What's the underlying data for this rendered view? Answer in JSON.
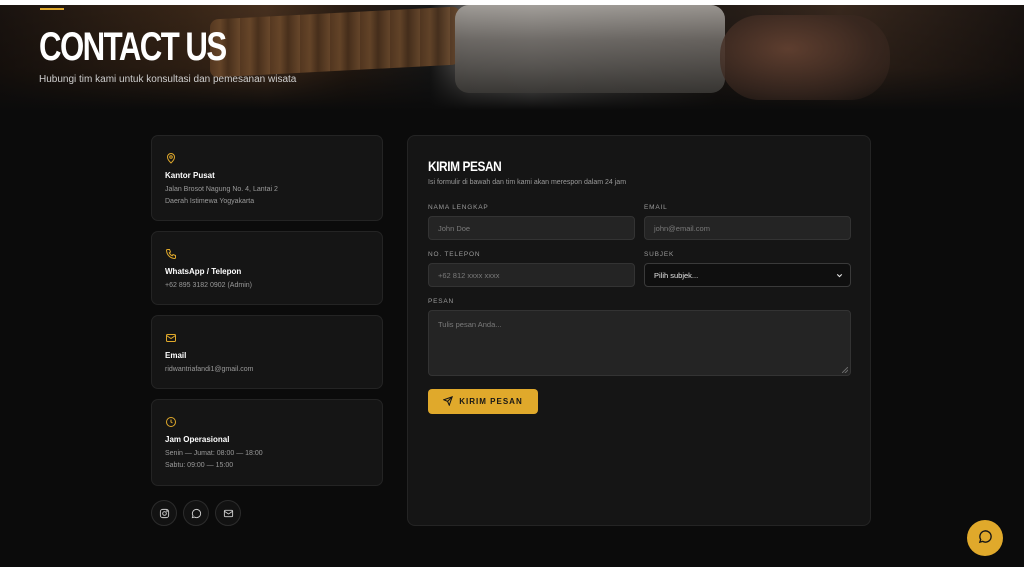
{
  "hero": {
    "title": "CONTACT US",
    "subtitle": "Hubungi tim kami untuk konsultasi dan pemesanan wisata"
  },
  "contact_cards": [
    {
      "icon": "map-pin-icon",
      "title": "Kantor Pusat",
      "lines": [
        "Jalan Brosot Nagung No. 4, Lantai 2",
        "Daerah Istimewa Yogyakarta"
      ]
    },
    {
      "icon": "phone-icon",
      "title": "WhatsApp / Telepon",
      "lines": [
        "+62 895 3182 0902 (Admin)"
      ]
    },
    {
      "icon": "mail-icon",
      "title": "Email",
      "lines": [
        "ridwantriafandi1@gmail.com"
      ]
    },
    {
      "icon": "clock-icon",
      "title": "Jam Operasional",
      "lines": [
        "Senin — Jumat: 08:00 — 18:00",
        "Sabtu: 09:00 — 15:00"
      ]
    }
  ],
  "socials": [
    "instagram-icon",
    "chat-icon",
    "mail-icon"
  ],
  "form": {
    "title": "KIRIM PESAN",
    "subtitle": "Isi formulir di bawah dan tim kami akan merespon dalam 24 jam",
    "name_label": "NAMA LENGKAP",
    "name_placeholder": "John Doe",
    "email_label": "EMAIL",
    "email_placeholder": "john@email.com",
    "phone_label": "NO. TELEPON",
    "phone_placeholder": "+62 812 xxxx xxxx",
    "subject_label": "SUBJEK",
    "subject_selected": "Pilih subjek...",
    "message_label": "PESAN",
    "message_placeholder": "Tulis pesan Anda...",
    "submit_label": "KIRIM PESAN"
  },
  "colors": {
    "accent": "#e0a92b",
    "background": "#0b0b0b",
    "card": "#151515"
  }
}
